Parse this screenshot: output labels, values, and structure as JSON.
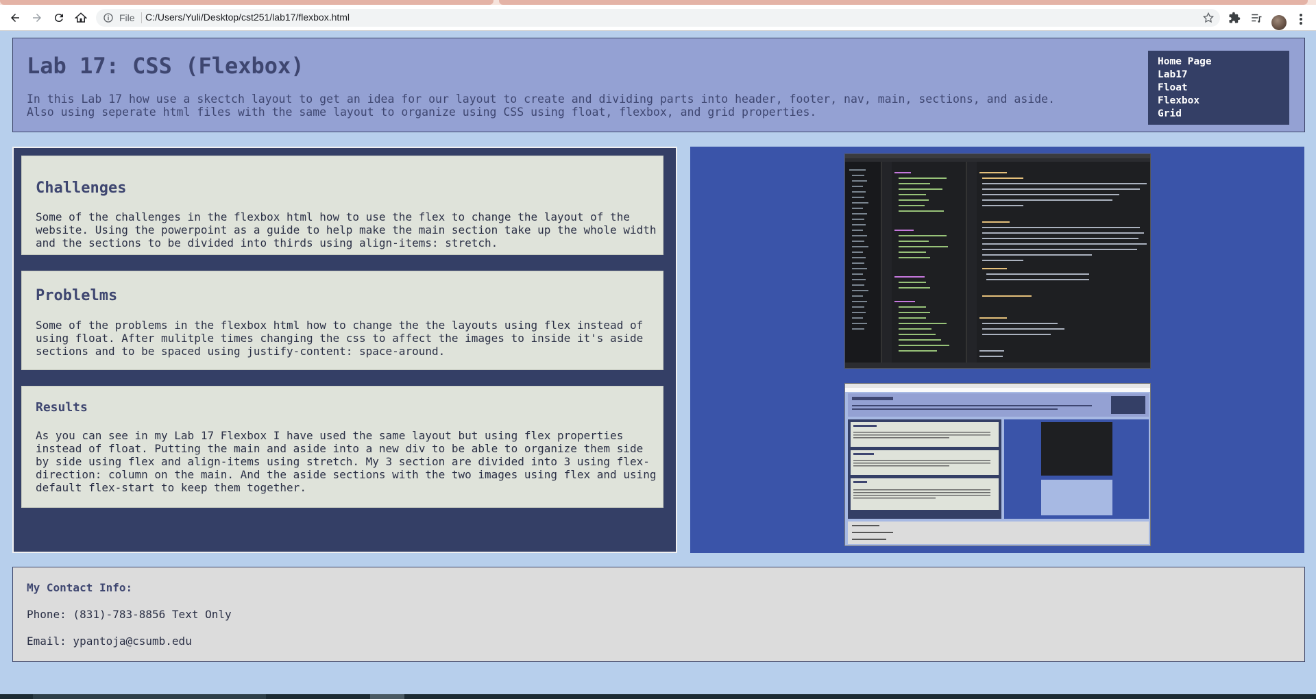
{
  "browser": {
    "omnibox_scheme": "File",
    "url": "C:/Users/Yuli/Desktop/cst251/lab17/flexbox.html",
    "icons": [
      "back-icon",
      "forward-icon",
      "reload-icon",
      "home-icon",
      "info-icon",
      "star-icon",
      "extensions-icon",
      "reading-list-icon",
      "avatar",
      "menu-icon"
    ]
  },
  "header": {
    "title": "Lab 17: CSS (Flexbox)",
    "description": "In this Lab 17 how use a skectch layout to get an idea for our layout to create and dividing parts into header, footer, nav, main, sections, and aside. Also using seperate html files with the same layout to organize using CSS using float, flexbox, and grid properties."
  },
  "nav": {
    "items": [
      "Home Page",
      "Lab17",
      "Float",
      "Flexbox",
      "Grid"
    ]
  },
  "sections": [
    {
      "heading": "Challenges",
      "body": "Some of the challenges in the flexbox html how to use the flex to change the layout of the website. Using the powerpoint as a guide to help make the main section take up the whole width and the sections to be divided into thirds using align-items: stretch."
    },
    {
      "heading": "Problelms",
      "body": "Some of the problems in the flexbox html how to change the the layouts using flex instead of using float. After mulitple times changing the css to affect the images to inside it's aside sections and to be spaced using justify-content: space-around."
    },
    {
      "heading": "Results",
      "body": "As you can see in my Lab 17 Flexbox I have used the same layout but using flex properties instead of float. Putting the main and aside into a new div to be able to organize them side by side using flex and align-items using stretch. My 3 section are divided into 3 using flex-direction: column on the main. And the aside sections with the two images using flex and using default flex-start to keep them together."
    }
  ],
  "footer": {
    "heading": "My Contact Info:",
    "phone": "Phone: (831)-783-8856 Text Only",
    "email": "Email: ypantoja@csumb.edu"
  },
  "colors": {
    "page_bg": "#b7cfec",
    "header_bg": "#94a1d3",
    "nav_bg": "#343f66",
    "main_bg": "#343f66",
    "section_bg": "#dfe3da",
    "aside_bg": "#3a54a9",
    "footer_bg": "#dcdcdc",
    "heading_text": "#3e4670"
  }
}
